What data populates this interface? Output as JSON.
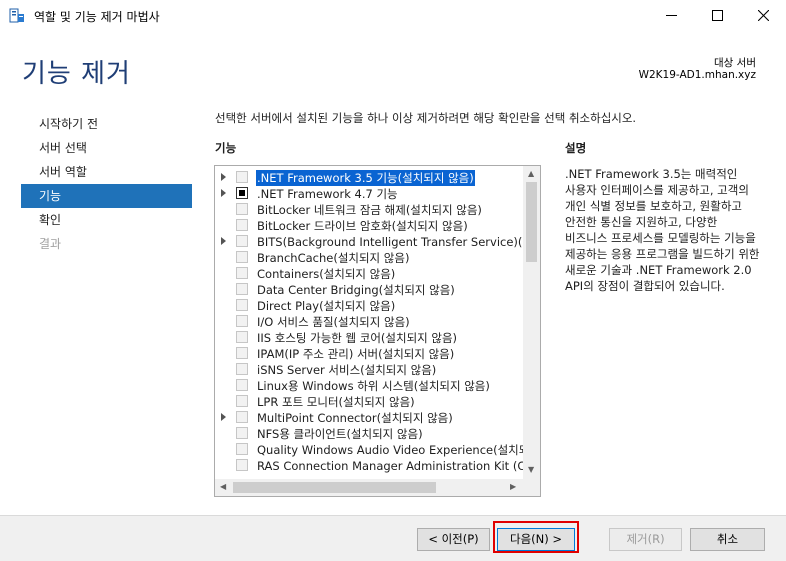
{
  "window": {
    "title": "역할 및 기능 제거 마법사",
    "minimize_icon": "minimize-icon",
    "maximize_icon": "maximize-icon",
    "close_icon": "close-icon"
  },
  "header": {
    "page_title": "기능 제거",
    "server_label": "대상 서버",
    "server_name": "W2K19-AD1.mhan.xyz"
  },
  "nav": {
    "items": [
      {
        "label": "시작하기 전",
        "state": "normal"
      },
      {
        "label": "서버 선택",
        "state": "normal"
      },
      {
        "label": "서버 역할",
        "state": "normal"
      },
      {
        "label": "기능",
        "state": "active"
      },
      {
        "label": "확인",
        "state": "normal"
      },
      {
        "label": "결과",
        "state": "disabled"
      }
    ]
  },
  "main": {
    "instruction": "선택한 서버에서 설치된 기능을 하나 이상 제거하려면 해당 확인란을 선택 취소하십시오.",
    "features_heading": "기능",
    "description_heading": "설명",
    "description": ".NET Framework 3.5는 매력적인 사용자 인터페이스를 제공하고, 고객의 개인 식별 정보를 보호하고, 원활하고 안전한 통신을 지원하고, 다양한 비즈니스 프로세스를 모델링하는 기능을 제공하는 응용 프로그램을 빌드하기 위한 새로운 기술과 .NET Framework 2.0 API의 장점이 결합되어 있습니다."
  },
  "features": [
    {
      "label": ".NET Framework 3.5 기능(설치되지 않음)",
      "expandable": true,
      "check": "unchecked",
      "selected": true
    },
    {
      "label": ".NET Framework 4.7 기능",
      "expandable": true,
      "check": "partial",
      "selected": false
    },
    {
      "label": "BitLocker 네트워크 잠금 해제(설치되지 않음)",
      "expandable": false,
      "check": "unchecked",
      "selected": false
    },
    {
      "label": "BitLocker 드라이브 암호화(설치되지 않음)",
      "expandable": false,
      "check": "unchecked",
      "selected": false
    },
    {
      "label": "BITS(Background Intelligent Transfer Service)(설치되지 않음)",
      "expandable": true,
      "check": "unchecked",
      "selected": false
    },
    {
      "label": "BranchCache(설치되지 않음)",
      "expandable": false,
      "check": "unchecked",
      "selected": false
    },
    {
      "label": "Containers(설치되지 않음)",
      "expandable": false,
      "check": "unchecked",
      "selected": false
    },
    {
      "label": "Data Center Bridging(설치되지 않음)",
      "expandable": false,
      "check": "unchecked",
      "selected": false
    },
    {
      "label": "Direct Play(설치되지 않음)",
      "expandable": false,
      "check": "unchecked",
      "selected": false
    },
    {
      "label": "I/O 서비스 품질(설치되지 않음)",
      "expandable": false,
      "check": "unchecked",
      "selected": false
    },
    {
      "label": "IIS 호스팅 가능한 웹 코어(설치되지 않음)",
      "expandable": false,
      "check": "unchecked",
      "selected": false
    },
    {
      "label": "IPAM(IP 주소 관리) 서버(설치되지 않음)",
      "expandable": false,
      "check": "unchecked",
      "selected": false
    },
    {
      "label": "iSNS Server 서비스(설치되지 않음)",
      "expandable": false,
      "check": "unchecked",
      "selected": false
    },
    {
      "label": "Linux용 Windows 하위 시스템(설치되지 않음)",
      "expandable": false,
      "check": "unchecked",
      "selected": false
    },
    {
      "label": "LPR 포트 모니터(설치되지 않음)",
      "expandable": false,
      "check": "unchecked",
      "selected": false
    },
    {
      "label": "MultiPoint Connector(설치되지 않음)",
      "expandable": true,
      "check": "unchecked",
      "selected": false
    },
    {
      "label": "NFS용 클라이언트(설치되지 않음)",
      "expandable": false,
      "check": "unchecked",
      "selected": false
    },
    {
      "label": "Quality Windows Audio Video Experience(설치되지 않음)",
      "expandable": false,
      "check": "unchecked",
      "selected": false
    },
    {
      "label": "RAS Connection Manager Administration Kit (CMAK)(설치되지 않음)",
      "expandable": false,
      "check": "unchecked",
      "selected": false
    }
  ],
  "buttons": {
    "previous": "< 이전(P)",
    "next": "다음(N) >",
    "remove": "제거(R)",
    "cancel": "취소"
  }
}
